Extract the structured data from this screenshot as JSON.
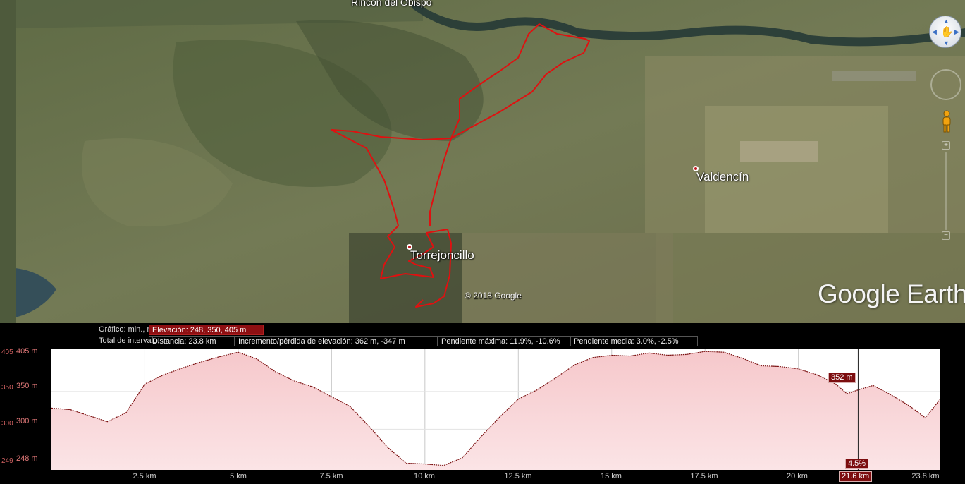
{
  "map": {
    "places": {
      "top": "Rincón del Obispo",
      "town_a": "Torrejoncillo",
      "town_b": "Valdencín"
    },
    "copyright": "© 2018 Google",
    "logo": "Google Earth",
    "icons": [
      "navigation-compass-icon",
      "hand-icon",
      "look-ring-icon",
      "pegman-icon",
      "zoom-slider-icon"
    ]
  },
  "profile": {
    "row1_label": "Gráfico: min., media, máx.:",
    "elevation": "Elevación: 248, 350, 405 m",
    "row2_label": "Total de intervalo:",
    "distance": "Distancia: 23.8 km",
    "gain_loss": "Incremento/pérdida de elevación: 362 m, -347 m",
    "max_slope": "Pendiente máxima: 11.9%, -10.6%",
    "avg_slope": "Pendiente media: 3.0%, -2.5%",
    "y_ticks_outer": [
      "405",
      "350",
      "300",
      "249"
    ],
    "y_ticks_inner": [
      "405 m",
      "350 m",
      "300 m",
      "248 m"
    ],
    "x_ticks": [
      "2.5 km",
      "5 km",
      "7.5 km",
      "10 km",
      "12.5 km",
      "15 km",
      "17.5 km",
      "20 km",
      "23.8 km"
    ],
    "cursor_elevation": "352 m",
    "cursor_slope": "4.5%",
    "cursor_distance": "21.6 km",
    "colors": {
      "fill": "#f6c8cb",
      "line": "#7a1010",
      "highlight": "#8e0f12",
      "route": "#e01010"
    }
  },
  "chart_data": {
    "type": "area",
    "title": "",
    "xlabel": "",
    "ylabel": "",
    "xlim": [
      0,
      23.8
    ],
    "ylim": [
      248,
      405
    ],
    "grid": true,
    "x": [
      0,
      0.5,
      1.0,
      1.5,
      2.0,
      2.5,
      3.0,
      3.5,
      4.0,
      4.5,
      5.0,
      5.5,
      6.0,
      6.5,
      7.0,
      7.5,
      8.0,
      8.5,
      9.0,
      9.5,
      10.0,
      10.5,
      11.0,
      11.5,
      12.0,
      12.5,
      13.0,
      13.5,
      14.0,
      14.5,
      15.0,
      15.5,
      16.0,
      16.5,
      17.0,
      17.5,
      18.0,
      18.5,
      19.0,
      19.5,
      20.0,
      20.5,
      21.0,
      21.3,
      21.6,
      22.0,
      22.5,
      23.0,
      23.4,
      23.8
    ],
    "y": [
      328,
      326,
      318,
      310,
      322,
      360,
      372,
      381,
      389,
      396,
      402,
      393,
      376,
      364,
      356,
      343,
      330,
      304,
      276,
      255,
      254,
      252,
      262,
      290,
      316,
      340,
      352,
      368,
      385,
      395,
      398,
      397,
      401,
      398,
      399,
      403,
      402,
      394,
      384,
      383,
      380,
      372,
      360,
      347,
      352,
      358,
      345,
      330,
      315,
      340
    ]
  }
}
